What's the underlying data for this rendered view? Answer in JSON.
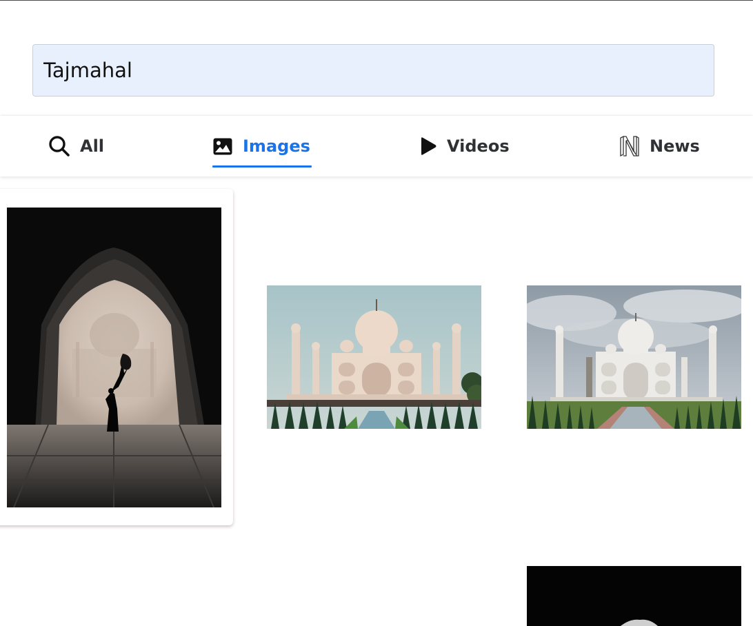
{
  "search": {
    "value": "Tajmahal"
  },
  "tabs": [
    {
      "label": "All",
      "icon": "search-icon",
      "active": false
    },
    {
      "label": "Images",
      "icon": "image-icon",
      "active": true
    },
    {
      "label": "Videos",
      "icon": "play-icon",
      "active": false
    },
    {
      "label": "News",
      "icon": "news-icon",
      "active": false
    }
  ],
  "colors": {
    "accent": "#1a73e8",
    "search_bg": "#e8f0fe",
    "tab_text": "#303134"
  },
  "results": [
    {
      "subject": "woman silhouette in arch framing Taj Mahal in fog, black and white",
      "selected": true
    },
    {
      "subject": "Taj Mahal at dusk with reflecting pool",
      "selected": false
    },
    {
      "subject": "Taj Mahal under cloudy sky with gardens",
      "selected": false
    },
    {
      "subject": "dark arch photo, partially visible",
      "selected": false
    }
  ]
}
